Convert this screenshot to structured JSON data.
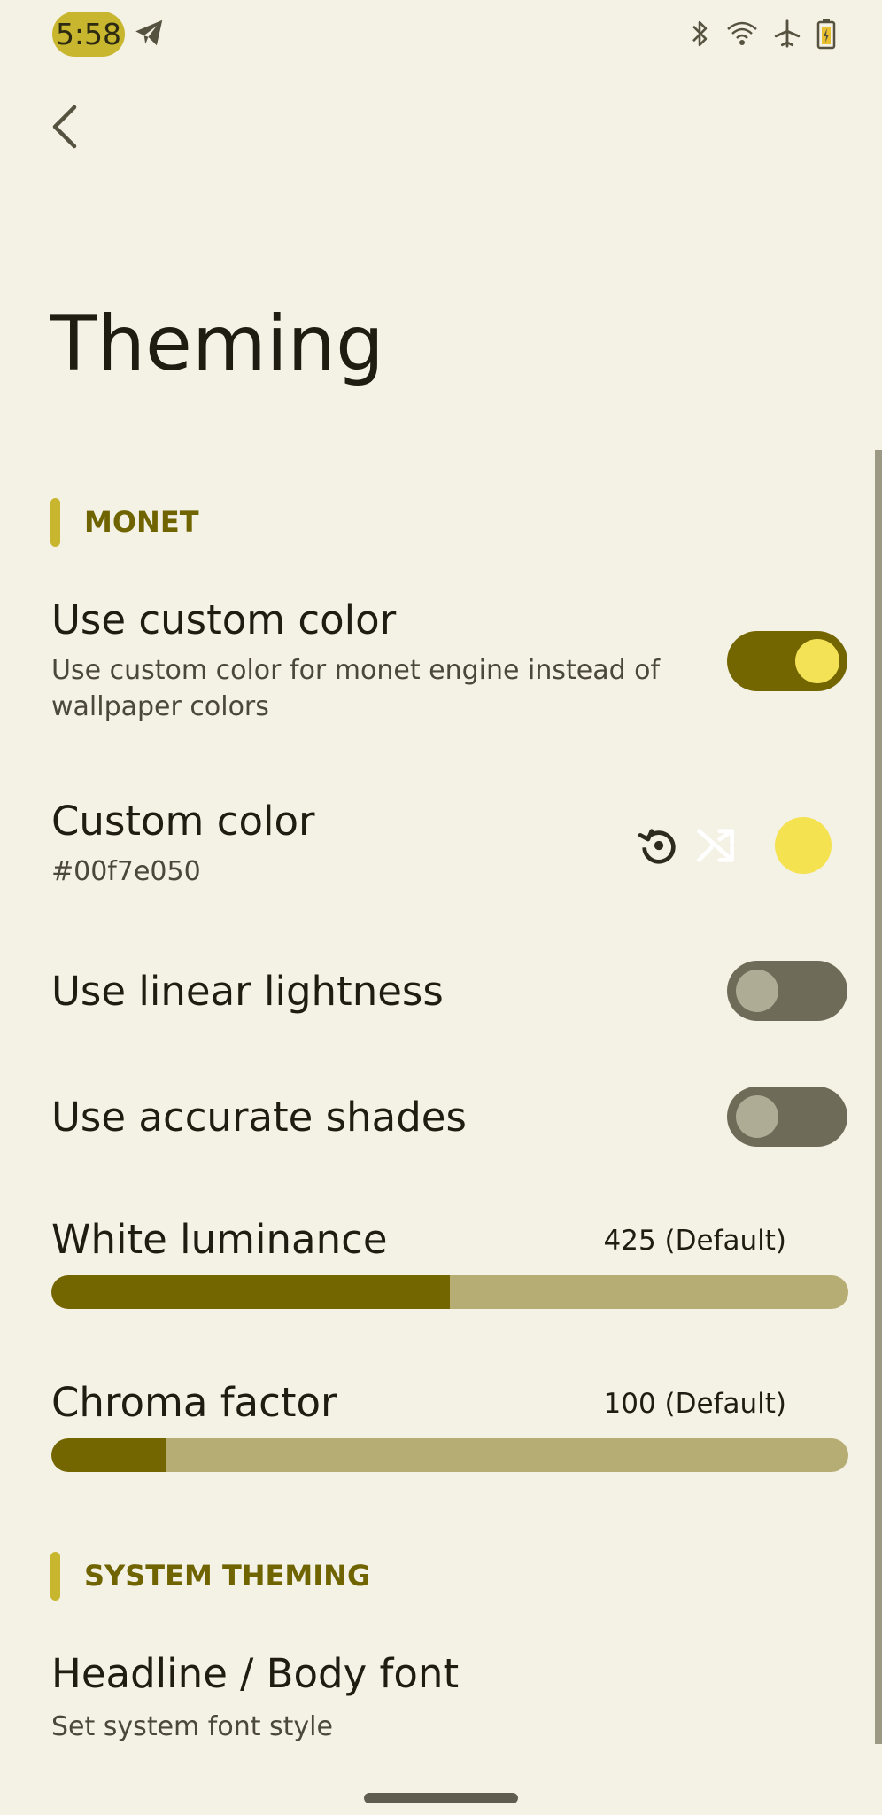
{
  "status_bar": {
    "time": "5:58",
    "icons": [
      "telegram-icon",
      "bluetooth-icon",
      "wifi-icon",
      "airplane-icon",
      "battery-icon"
    ]
  },
  "header": {
    "back_icon": "arrow-back-icon",
    "title": "Theming"
  },
  "sections": {
    "monet": {
      "label": "MONET",
      "use_custom_color": {
        "title": "Use custom color",
        "summary": "Use custom color for monet engine instead of wallpaper colors",
        "enabled": true
      },
      "custom_color": {
        "title": "Custom color",
        "value": "#00f7e050",
        "swatch_color": "#f4e250",
        "reset_icon": "reset-icon",
        "shuffle_icon": "shuffle-icon"
      },
      "linear_lightness": {
        "title": "Use linear lightness",
        "enabled": false
      },
      "accurate_shades": {
        "title": "Use accurate shades",
        "enabled": false
      },
      "white_luminance": {
        "title": "White luminance",
        "value_label": "425 (Default)",
        "fill_fraction": 0.5
      },
      "chroma_factor": {
        "title": "Chroma factor",
        "value_label": "100 (Default)",
        "fill_fraction": 0.143
      }
    },
    "system_theming": {
      "label": "SYSTEM THEMING",
      "headline_body_font": {
        "title": "Headline / Body font",
        "summary": "Set system font style"
      }
    }
  },
  "colors": {
    "background": "#f4f1e5",
    "accent": "#736600",
    "accent_light": "#c8b62f",
    "track": "#b6ad74"
  }
}
